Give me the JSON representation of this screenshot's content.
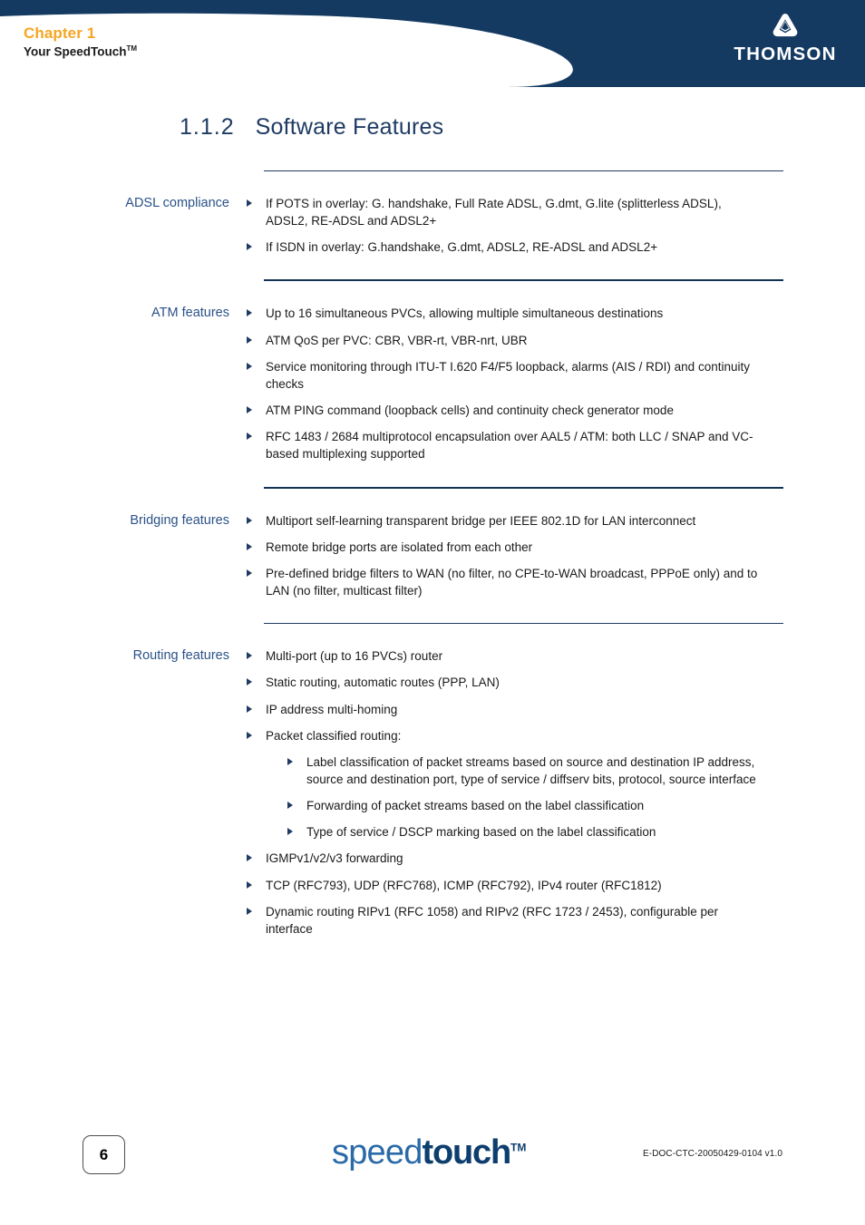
{
  "header": {
    "chapter_label": "Chapter 1",
    "chapter_subtitle": "Your SpeedTouch",
    "chapter_subtitle_tm": "TM",
    "brand_name": "THOMSON",
    "brand_color": "#153a62",
    "chapter_color": "#f5a623"
  },
  "title": {
    "number": "1.1.2",
    "text": "Software Features"
  },
  "sections": [
    {
      "label": "ADSL compliance",
      "rule_style": "thin",
      "items": [
        {
          "level": 1,
          "text": "If POTS in overlay: G. handshake, Full Rate ADSL, G.dmt, G.lite (splitterless ADSL), ADSL2, RE-ADSL and ADSL2+"
        },
        {
          "level": 1,
          "text": "If ISDN in overlay: G.handshake, G.dmt, ADSL2, RE-ADSL and ADSL2+"
        }
      ]
    },
    {
      "label": "ATM features",
      "rule_style": "thick",
      "items": [
        {
          "level": 1,
          "text": "Up to 16 simultaneous PVCs, allowing multiple simultaneous destinations"
        },
        {
          "level": 1,
          "text": "ATM QoS per PVC: CBR, VBR-rt, VBR-nrt, UBR"
        },
        {
          "level": 1,
          "text": "Service monitoring through ITU-T I.620 F4/F5 loopback, alarms (AIS / RDI) and continuity checks"
        },
        {
          "level": 1,
          "text": "ATM PING command (loopback cells) and continuity check generator mode"
        },
        {
          "level": 1,
          "text": "RFC 1483 / 2684 multiprotocol encapsulation over AAL5 / ATM: both LLC / SNAP and VC-based multiplexing supported"
        }
      ]
    },
    {
      "label": "Bridging features",
      "rule_style": "thick",
      "items": [
        {
          "level": 1,
          "text": "Multiport self-learning transparent bridge per IEEE 802.1D for LAN interconnect"
        },
        {
          "level": 1,
          "text": "Remote bridge ports are isolated from each other"
        },
        {
          "level": 1,
          "text": "Pre-defined bridge filters to WAN (no filter, no CPE-to-WAN broadcast, PPPoE only) and to LAN (no filter, multicast filter)"
        }
      ]
    },
    {
      "label": "Routing features",
      "rule_style": "thin",
      "items": [
        {
          "level": 1,
          "text": "Multi-port (up to 16 PVCs) router"
        },
        {
          "level": 1,
          "text": "Static routing, automatic routes (PPP, LAN)"
        },
        {
          "level": 1,
          "text": "IP address multi-homing"
        },
        {
          "level": 1,
          "text": "Packet classified routing:"
        },
        {
          "level": 2,
          "text": "Label classification of packet streams based on source and destination IP address, source and destination port, type of service / diffserv bits, protocol, source interface"
        },
        {
          "level": 2,
          "text": "Forwarding of packet streams based on the label classification"
        },
        {
          "level": 2,
          "text": "Type of service / DSCP marking based on the label classification"
        },
        {
          "level": 1,
          "text": "IGMPv1/v2/v3 forwarding"
        },
        {
          "level": 1,
          "text": "TCP (RFC793), UDP (RFC768), ICMP (RFC792), IPv4 router (RFC1812)"
        },
        {
          "level": 1,
          "text": "Dynamic routing RIPv1 (RFC 1058) and RIPv2 (RFC 1723 / 2453), configurable per interface"
        }
      ]
    }
  ],
  "footer": {
    "page_number": "6",
    "product_logo_part1": "speed",
    "product_logo_part2": "touch",
    "product_logo_tm": "TM",
    "doc_code": "E-DOC-CTC-20050429-0104 v1.0"
  }
}
